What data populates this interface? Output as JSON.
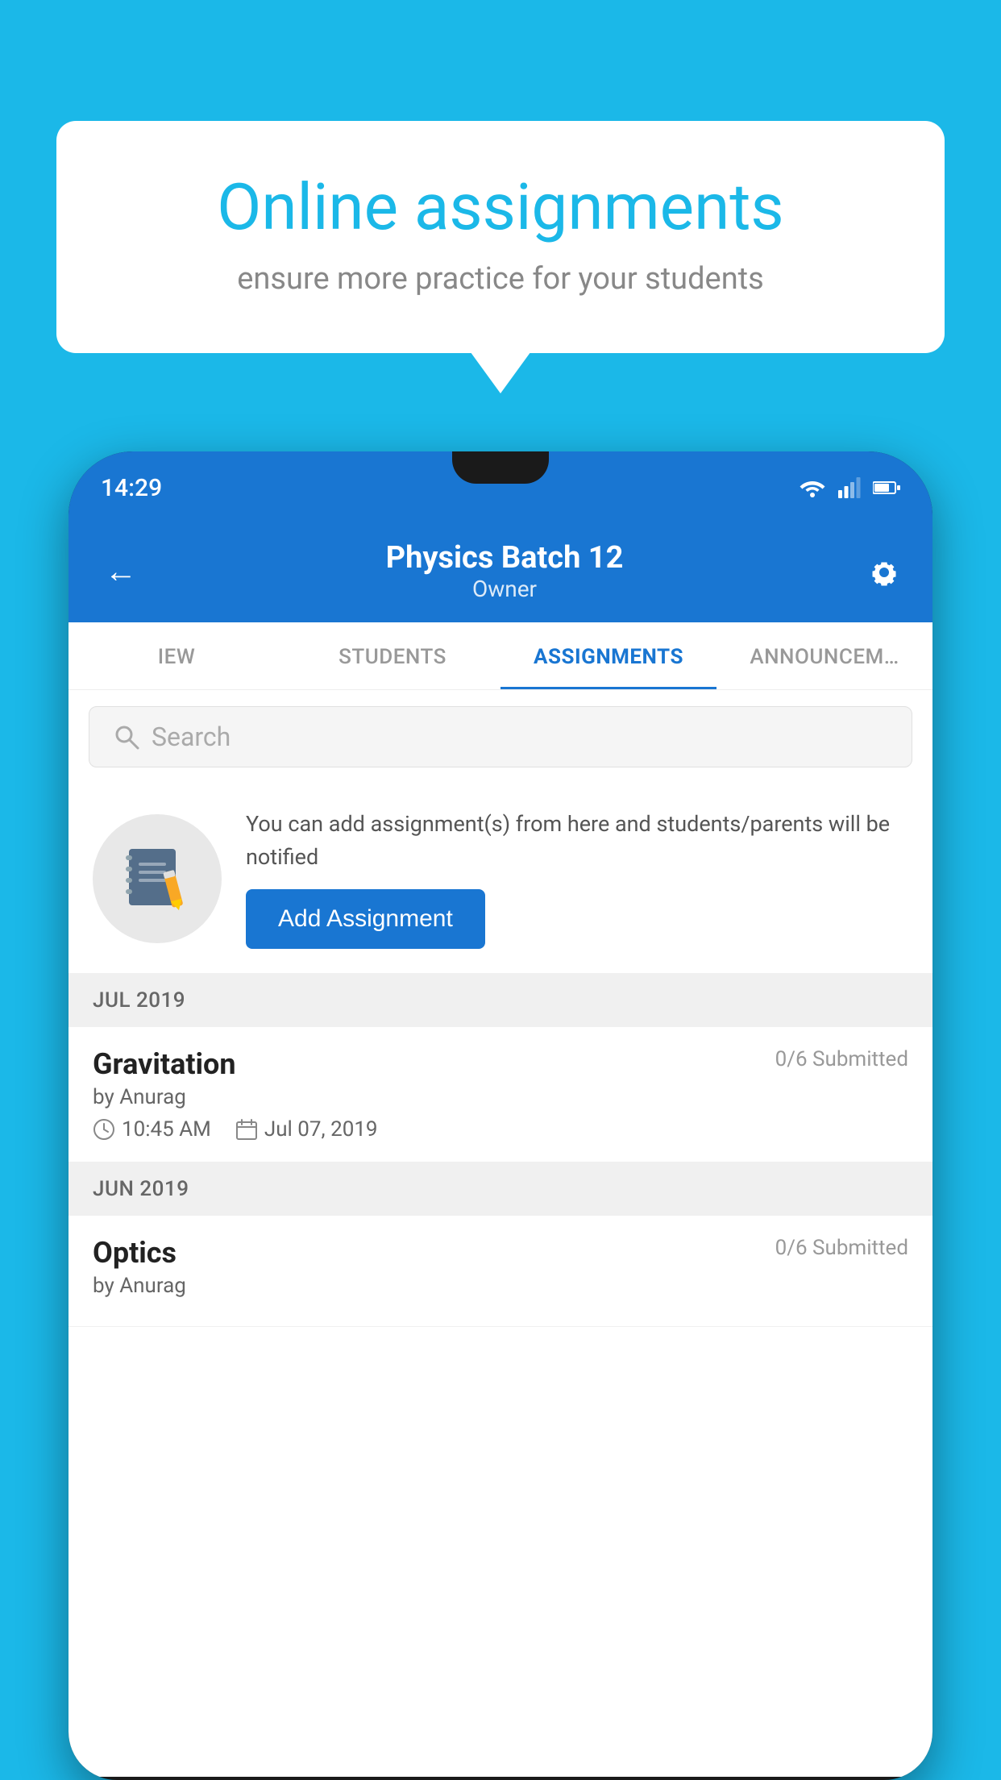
{
  "background": {
    "color": "#1bb8e8"
  },
  "speech_bubble": {
    "title": "Online assignments",
    "subtitle": "ensure more practice for your students"
  },
  "phone": {
    "status_bar": {
      "time": "14:29"
    },
    "header": {
      "back_label": "←",
      "title": "Physics Batch 12",
      "subtitle": "Owner",
      "settings_label": "⚙"
    },
    "tabs": [
      {
        "label": "IEW",
        "active": false
      },
      {
        "label": "STUDENTS",
        "active": false
      },
      {
        "label": "ASSIGNMENTS",
        "active": true
      },
      {
        "label": "ANNOUNCEM…",
        "active": false
      }
    ],
    "search": {
      "placeholder": "Search"
    },
    "info_card": {
      "description": "You can add assignment(s) from here and students/parents will be notified",
      "button_label": "Add Assignment"
    },
    "sections": [
      {
        "label": "JUL 2019",
        "assignments": [
          {
            "name": "Gravitation",
            "submitted": "0/6 Submitted",
            "author": "by Anurag",
            "time": "10:45 AM",
            "date": "Jul 07, 2019"
          }
        ]
      },
      {
        "label": "JUN 2019",
        "assignments": [
          {
            "name": "Optics",
            "submitted": "0/6 Submitted",
            "author": "by Anurag",
            "time": "",
            "date": ""
          }
        ]
      }
    ]
  }
}
